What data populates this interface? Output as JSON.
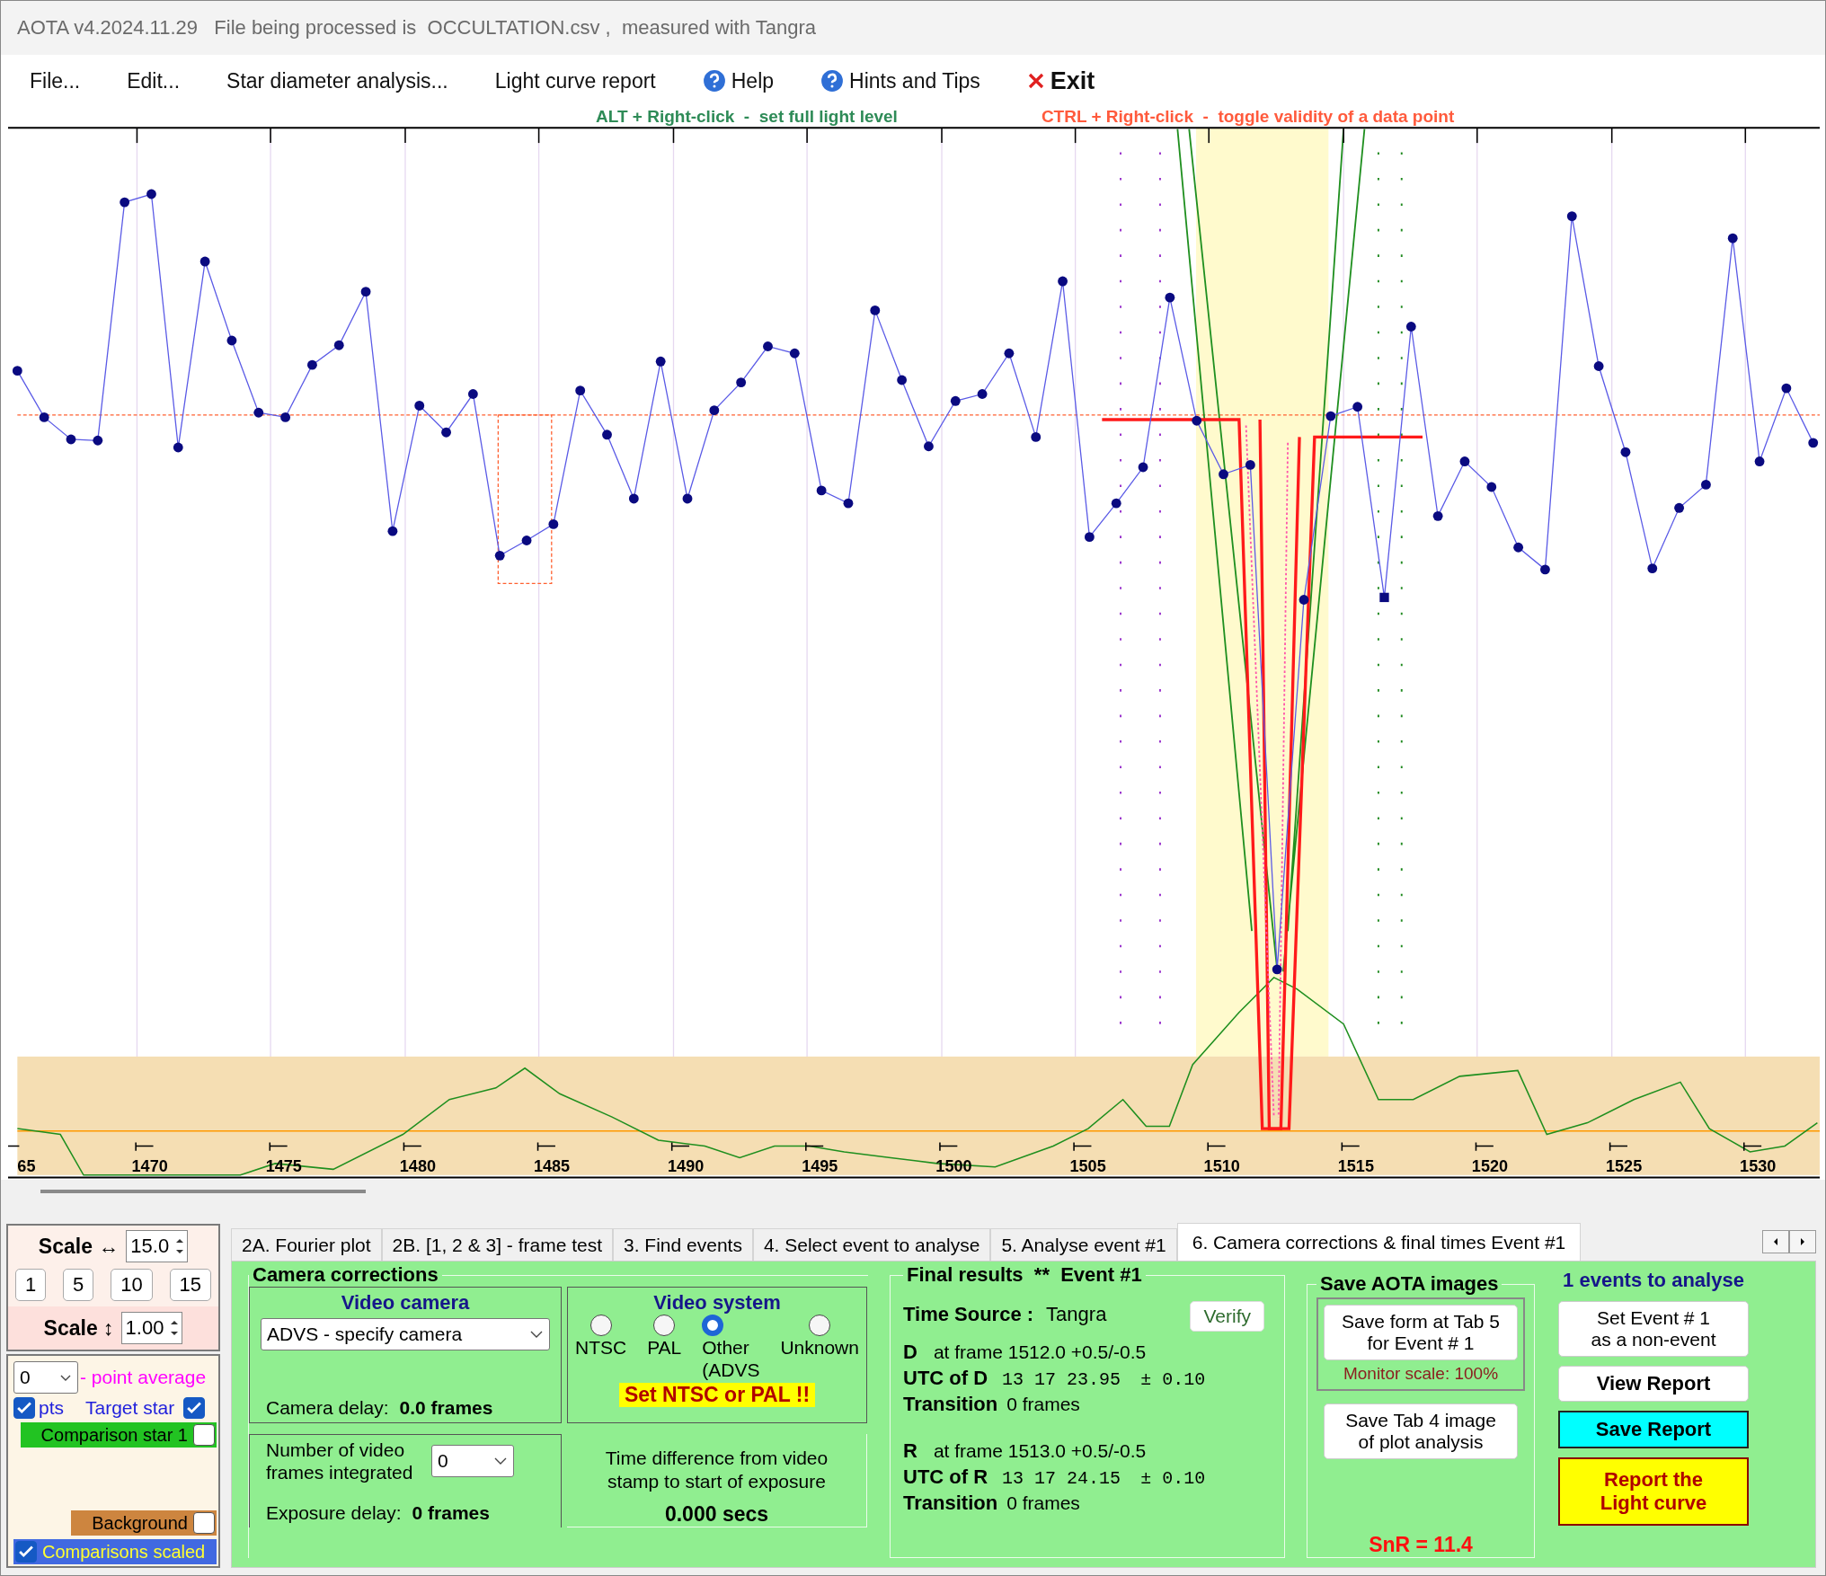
{
  "window": {
    "title": "AOTA v4.2024.11.29   File being processed is  OCCULTATION.csv ,  measured with Tangra"
  },
  "menu": [
    {
      "label": "File...",
      "kind": "plain"
    },
    {
      "label": "Edit...",
      "kind": "plain"
    },
    {
      "label": "Star diameter analysis...",
      "kind": "plain"
    },
    {
      "label": "Light curve report",
      "kind": "plain"
    },
    {
      "label": "Help",
      "kind": "help"
    },
    {
      "label": "Hints and Tips",
      "kind": "help"
    },
    {
      "label": "Exit",
      "kind": "exit"
    }
  ],
  "hints": [
    {
      "text": "ALT + Right-click  -  set full light level",
      "color": "#2e8b57"
    },
    {
      "text": "CTRL + Right-click  -  toggle validity of a data point",
      "color": "#ff5a3c"
    }
  ],
  "plot": {
    "x_tick_labels": [
      "65",
      "1470",
      "1475",
      "1480",
      "1485",
      "1490",
      "1495",
      "1500",
      "1505",
      "1510",
      "1515",
      "1520",
      "1525",
      "1530"
    ]
  },
  "scale_panel": {
    "h_label": "Scale ↔",
    "h_value": "15.0",
    "presets": [
      "1",
      "5",
      "10",
      "15"
    ],
    "v_label": "Scale ↕",
    "v_value": "1.00"
  },
  "series_panel": {
    "average_value": "0",
    "average_label": "- point average",
    "pts_label": "pts",
    "pts_checked": true,
    "rows": [
      {
        "label": "Target star",
        "kind": "target",
        "checked": true,
        "color": "#1e1edc"
      },
      {
        "label": "Comparison star 1",
        "kind": "comparison",
        "checked": false,
        "color": "#22c322"
      },
      {
        "label": "Background",
        "kind": "background",
        "checked": false,
        "color": "#cd853f"
      },
      {
        "label": "Comparisons scaled",
        "kind": "scaled",
        "checked": true,
        "color": "#4169e1"
      }
    ]
  },
  "tabs": [
    {
      "label": "2A. Fourier plot",
      "selected": false
    },
    {
      "label": "2B. [1, 2 & 3] - frame test",
      "selected": false
    },
    {
      "label": "3. Find events",
      "selected": false
    },
    {
      "label": "4. Select event to analyse",
      "selected": false
    },
    {
      "label": "5. Analyse event #1",
      "selected": false
    },
    {
      "label": "6. Camera corrections & final times Event #1",
      "selected": true
    }
  ],
  "camera_corrections": {
    "title": "Camera corrections",
    "video_camera": {
      "title": "Video camera",
      "value": "ADVS - specify camera",
      "delay_label": "Camera delay:",
      "delay_value": "0.0 frames"
    },
    "video_system": {
      "title": "Video system",
      "options": [
        {
          "label": "NTSC",
          "selected": false
        },
        {
          "label": "PAL",
          "selected": false
        },
        {
          "label": "Other\n(ADVS",
          "selected": true
        },
        {
          "label": "Unknown",
          "selected": false
        }
      ],
      "warning": "Set NTSC or PAL !!"
    },
    "integration": {
      "label": "Number of video frames integrated",
      "value": "0",
      "delay_label": "Exposure delay:",
      "delay_value": "0 frames"
    },
    "time_difference": {
      "label": "Time difference from video stamp to start of exposure",
      "value": "0.000 secs"
    }
  },
  "final_results": {
    "title": "Final results  **  Event #1",
    "verify": "Verify",
    "time_source_label": "Time Source :",
    "time_source": "Tangra",
    "events": [
      {
        "letter": "D",
        "frame": "at frame 1512.0  +0.5/-0.5",
        "utc_label": "UTC of D",
        "utc": "13 17 23.95",
        "uncertainty": "± 0.10",
        "transition_label": "Transition",
        "transition": "0 frames"
      },
      {
        "letter": "R",
        "frame": "at frame 1513.0  +0.5/-0.5",
        "utc_label": "UTC of R",
        "utc": "13 17 24.15",
        "uncertainty": "± 0.10",
        "transition_label": "Transition",
        "transition": "0 frames"
      }
    ]
  },
  "save_images": {
    "title": "Save AOTA images",
    "buttons": [
      "Save form at Tab 5\nfor Event # 1",
      "Save Tab 4 image\nof plot analysis"
    ],
    "monitor_scale": "Monitor scale: 100%",
    "snr": "SnR = 11.4"
  },
  "actions": {
    "title": "1 events to analyse",
    "buttons": [
      {
        "label": "Set Event # 1\nas a non-event",
        "kind": "plain"
      },
      {
        "label": "View Report",
        "kind": "bold"
      },
      {
        "label": "Save Report",
        "kind": "cyan"
      },
      {
        "label": "Report the\nLight curve",
        "kind": "yellow"
      }
    ]
  }
}
